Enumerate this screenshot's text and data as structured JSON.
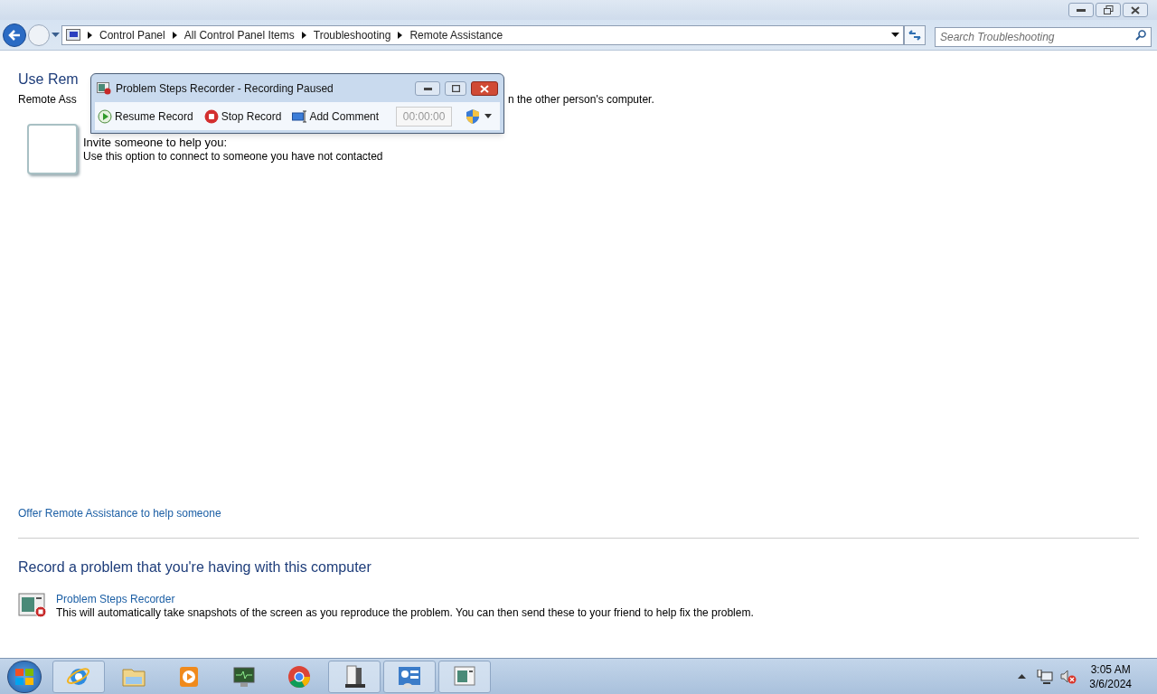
{
  "address_bar": {
    "breadcrumbs": [
      "Control Panel",
      "All Control Panel Items",
      "Troubleshooting",
      "Remote Assistance"
    ],
    "search": {
      "placeholder": "Search Troubleshooting"
    }
  },
  "page": {
    "heading_visible": "Use Rem",
    "intro_left": "Remote Ass",
    "intro_right": "n the other person's computer.",
    "invite_title": "Invite someone to help you:",
    "invite_description": "Use this option to connect to someone you have not contacted",
    "offer_link": "Offer Remote Assistance to help someone",
    "record_heading": "Record a problem that you're having with this computer",
    "psr_link": "Problem Steps Recorder",
    "psr_description": "This will automatically take snapshots of the screen as you reproduce the problem. You can then send these to your friend to help fix the problem."
  },
  "recorder": {
    "title": "Problem Steps Recorder - Recording Paused",
    "buttons": [
      {
        "kind": "resume",
        "label": "Resume Record"
      },
      {
        "kind": "stop",
        "label": "Stop Record"
      },
      {
        "kind": "comment",
        "label": "Add Comment"
      }
    ],
    "timer": "00:00:00"
  },
  "taskbar": {
    "items": [
      {
        "kind": "ie",
        "active": true
      },
      {
        "kind": "folder",
        "active": false
      },
      {
        "kind": "media",
        "active": false
      },
      {
        "kind": "monitor",
        "active": false
      },
      {
        "kind": "chrome",
        "active": false
      },
      {
        "kind": "server",
        "active": true
      },
      {
        "kind": "panel",
        "active": true
      },
      {
        "kind": "psr",
        "active": true
      }
    ],
    "time": "3:05 AM",
    "date": "3/6/2024"
  }
}
